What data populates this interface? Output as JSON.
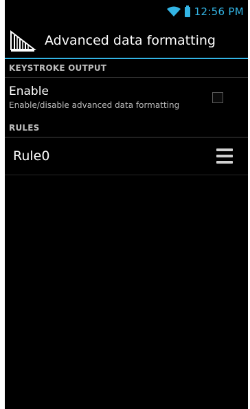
{
  "status_bar": {
    "time": "12:56 PM",
    "wifi_icon": "wifi-icon",
    "battery_icon": "battery-icon",
    "accent_color": "#33b5e5"
  },
  "action_bar": {
    "icon": "barcode-app-icon",
    "title": "Advanced data formatting"
  },
  "sections": {
    "keystroke_output": {
      "header": "KEYSTROKE OUTPUT",
      "enable": {
        "title": "Enable",
        "summary": "Enable/disable advanced data formatting",
        "checked": false
      }
    },
    "rules": {
      "header": "RULES",
      "items": [
        {
          "label": "Rule0",
          "handle_icon": "drag-handle-icon"
        }
      ]
    }
  }
}
